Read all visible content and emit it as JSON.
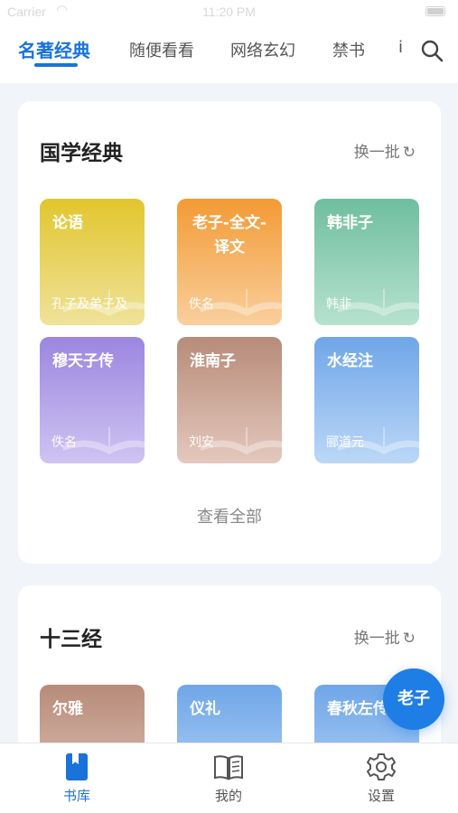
{
  "status_bar": {
    "carrier": "Carrier",
    "time": "11:20 PM"
  },
  "top_tabs": [
    {
      "label": "名著经典",
      "active": true
    },
    {
      "label": "随便看看",
      "active": false
    },
    {
      "label": "网络玄幻",
      "active": false
    },
    {
      "label": "禁书",
      "active": false
    },
    {
      "label": "i",
      "active": false
    }
  ],
  "sections": [
    {
      "title": "国学经典",
      "refresh_label": "换一批",
      "books": [
        {
          "title": "论语",
          "author": "孔子及弟子及",
          "gradient": [
            "#e2c62e",
            "#efe29a"
          ]
        },
        {
          "title": "老子-全文-译文",
          "author": "佚名",
          "gradient": [
            "#f39a34",
            "#f9cf9d"
          ]
        },
        {
          "title": "韩非子",
          "author": "韩非",
          "gradient": [
            "#6fbe9f",
            "#b6e2cf"
          ]
        },
        {
          "title": "穆天子传",
          "author": "佚名",
          "gradient": [
            "#9b86e0",
            "#cfc4f2"
          ]
        },
        {
          "title": "淮南子",
          "author": "刘安",
          "gradient": [
            "#b78b79",
            "#e4c8bd"
          ]
        },
        {
          "title": "水经注",
          "author": "郦道元",
          "gradient": [
            "#6fa6e8",
            "#bcd7f7"
          ]
        }
      ],
      "view_all_label": "查看全部"
    },
    {
      "title": "十三经",
      "refresh_label": "换一批",
      "books": [
        {
          "title": "尔雅",
          "author": "",
          "gradient": [
            "#b78b79",
            "#e4c8bd"
          ]
        },
        {
          "title": "仪礼",
          "author": "",
          "gradient": [
            "#6fa6e8",
            "#bcd7f7"
          ]
        },
        {
          "title": "春秋左传",
          "author": "",
          "gradient": [
            "#6fa6e8",
            "#bcd7f7"
          ]
        }
      ]
    }
  ],
  "fab": {
    "label": "老子"
  },
  "bottom_nav": [
    {
      "label": "书库",
      "icon": "bookmark-book-icon",
      "active": true
    },
    {
      "label": "我的",
      "icon": "open-book-icon",
      "active": false
    },
    {
      "label": "设置",
      "icon": "gear-icon",
      "active": false
    }
  ],
  "colors": {
    "accent": "#1a73d9",
    "background": "#f1f4f8",
    "fab": "#1f7de6"
  }
}
